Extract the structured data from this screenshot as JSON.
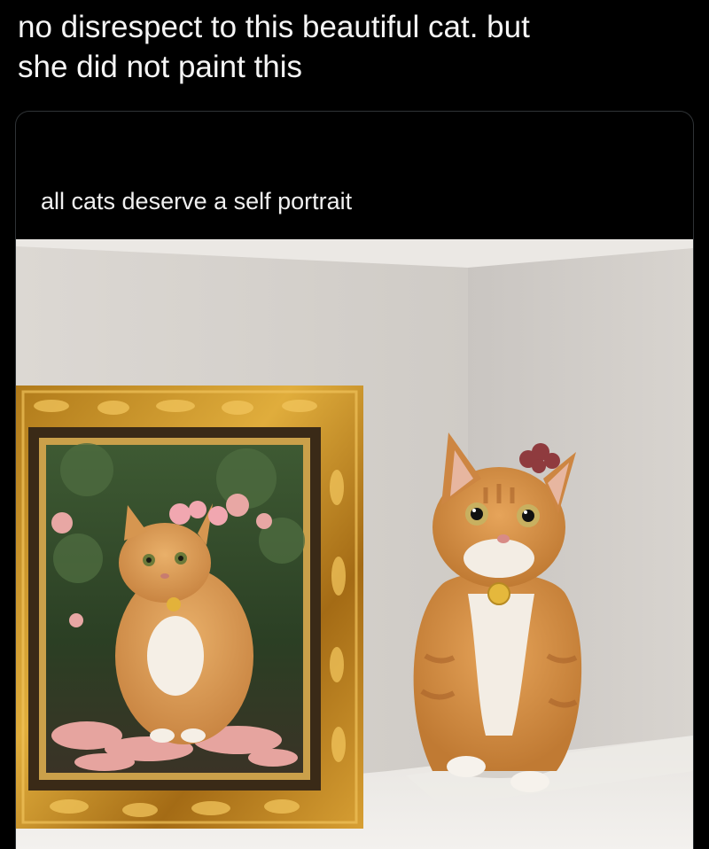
{
  "post": {
    "text": "no disrespect to this beautiful cat. but\nshe did not paint this"
  },
  "quoted_post": {
    "text": "all cats deserve a self portrait",
    "image_subject": "cat-photo"
  },
  "colors": {
    "background": "#000000",
    "text": "#f5f5f5",
    "card_border": "#2f3336"
  }
}
